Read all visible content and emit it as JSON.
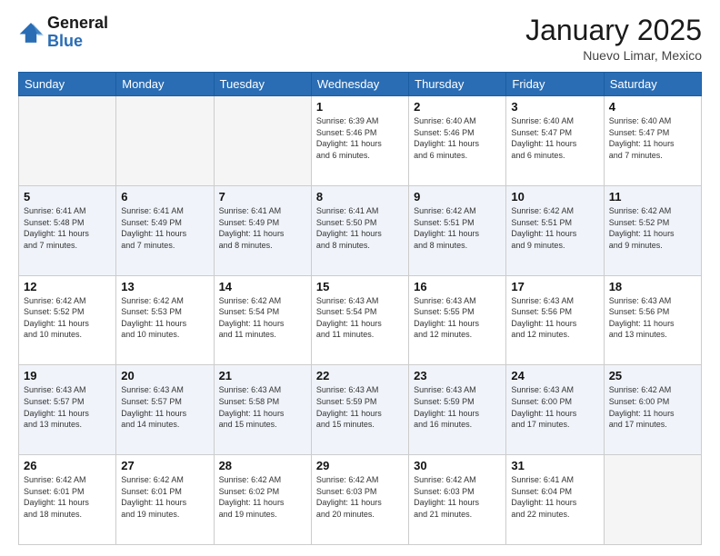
{
  "header": {
    "logo_text_general": "General",
    "logo_text_blue": "Blue",
    "title": "January 2025",
    "subtitle": "Nuevo Limar, Mexico"
  },
  "weekdays": [
    "Sunday",
    "Monday",
    "Tuesday",
    "Wednesday",
    "Thursday",
    "Friday",
    "Saturday"
  ],
  "weeks": [
    [
      {
        "day": "",
        "info": ""
      },
      {
        "day": "",
        "info": ""
      },
      {
        "day": "",
        "info": ""
      },
      {
        "day": "1",
        "info": "Sunrise: 6:39 AM\nSunset: 5:46 PM\nDaylight: 11 hours\nand 6 minutes."
      },
      {
        "day": "2",
        "info": "Sunrise: 6:40 AM\nSunset: 5:46 PM\nDaylight: 11 hours\nand 6 minutes."
      },
      {
        "day": "3",
        "info": "Sunrise: 6:40 AM\nSunset: 5:47 PM\nDaylight: 11 hours\nand 6 minutes."
      },
      {
        "day": "4",
        "info": "Sunrise: 6:40 AM\nSunset: 5:47 PM\nDaylight: 11 hours\nand 7 minutes."
      }
    ],
    [
      {
        "day": "5",
        "info": "Sunrise: 6:41 AM\nSunset: 5:48 PM\nDaylight: 11 hours\nand 7 minutes."
      },
      {
        "day": "6",
        "info": "Sunrise: 6:41 AM\nSunset: 5:49 PM\nDaylight: 11 hours\nand 7 minutes."
      },
      {
        "day": "7",
        "info": "Sunrise: 6:41 AM\nSunset: 5:49 PM\nDaylight: 11 hours\nand 8 minutes."
      },
      {
        "day": "8",
        "info": "Sunrise: 6:41 AM\nSunset: 5:50 PM\nDaylight: 11 hours\nand 8 minutes."
      },
      {
        "day": "9",
        "info": "Sunrise: 6:42 AM\nSunset: 5:51 PM\nDaylight: 11 hours\nand 8 minutes."
      },
      {
        "day": "10",
        "info": "Sunrise: 6:42 AM\nSunset: 5:51 PM\nDaylight: 11 hours\nand 9 minutes."
      },
      {
        "day": "11",
        "info": "Sunrise: 6:42 AM\nSunset: 5:52 PM\nDaylight: 11 hours\nand 9 minutes."
      }
    ],
    [
      {
        "day": "12",
        "info": "Sunrise: 6:42 AM\nSunset: 5:52 PM\nDaylight: 11 hours\nand 10 minutes."
      },
      {
        "day": "13",
        "info": "Sunrise: 6:42 AM\nSunset: 5:53 PM\nDaylight: 11 hours\nand 10 minutes."
      },
      {
        "day": "14",
        "info": "Sunrise: 6:42 AM\nSunset: 5:54 PM\nDaylight: 11 hours\nand 11 minutes."
      },
      {
        "day": "15",
        "info": "Sunrise: 6:43 AM\nSunset: 5:54 PM\nDaylight: 11 hours\nand 11 minutes."
      },
      {
        "day": "16",
        "info": "Sunrise: 6:43 AM\nSunset: 5:55 PM\nDaylight: 11 hours\nand 12 minutes."
      },
      {
        "day": "17",
        "info": "Sunrise: 6:43 AM\nSunset: 5:56 PM\nDaylight: 11 hours\nand 12 minutes."
      },
      {
        "day": "18",
        "info": "Sunrise: 6:43 AM\nSunset: 5:56 PM\nDaylight: 11 hours\nand 13 minutes."
      }
    ],
    [
      {
        "day": "19",
        "info": "Sunrise: 6:43 AM\nSunset: 5:57 PM\nDaylight: 11 hours\nand 13 minutes."
      },
      {
        "day": "20",
        "info": "Sunrise: 6:43 AM\nSunset: 5:57 PM\nDaylight: 11 hours\nand 14 minutes."
      },
      {
        "day": "21",
        "info": "Sunrise: 6:43 AM\nSunset: 5:58 PM\nDaylight: 11 hours\nand 15 minutes."
      },
      {
        "day": "22",
        "info": "Sunrise: 6:43 AM\nSunset: 5:59 PM\nDaylight: 11 hours\nand 15 minutes."
      },
      {
        "day": "23",
        "info": "Sunrise: 6:43 AM\nSunset: 5:59 PM\nDaylight: 11 hours\nand 16 minutes."
      },
      {
        "day": "24",
        "info": "Sunrise: 6:43 AM\nSunset: 6:00 PM\nDaylight: 11 hours\nand 17 minutes."
      },
      {
        "day": "25",
        "info": "Sunrise: 6:42 AM\nSunset: 6:00 PM\nDaylight: 11 hours\nand 17 minutes."
      }
    ],
    [
      {
        "day": "26",
        "info": "Sunrise: 6:42 AM\nSunset: 6:01 PM\nDaylight: 11 hours\nand 18 minutes."
      },
      {
        "day": "27",
        "info": "Sunrise: 6:42 AM\nSunset: 6:01 PM\nDaylight: 11 hours\nand 19 minutes."
      },
      {
        "day": "28",
        "info": "Sunrise: 6:42 AM\nSunset: 6:02 PM\nDaylight: 11 hours\nand 19 minutes."
      },
      {
        "day": "29",
        "info": "Sunrise: 6:42 AM\nSunset: 6:03 PM\nDaylight: 11 hours\nand 20 minutes."
      },
      {
        "day": "30",
        "info": "Sunrise: 6:42 AM\nSunset: 6:03 PM\nDaylight: 11 hours\nand 21 minutes."
      },
      {
        "day": "31",
        "info": "Sunrise: 6:41 AM\nSunset: 6:04 PM\nDaylight: 11 hours\nand 22 minutes."
      },
      {
        "day": "",
        "info": ""
      }
    ]
  ]
}
